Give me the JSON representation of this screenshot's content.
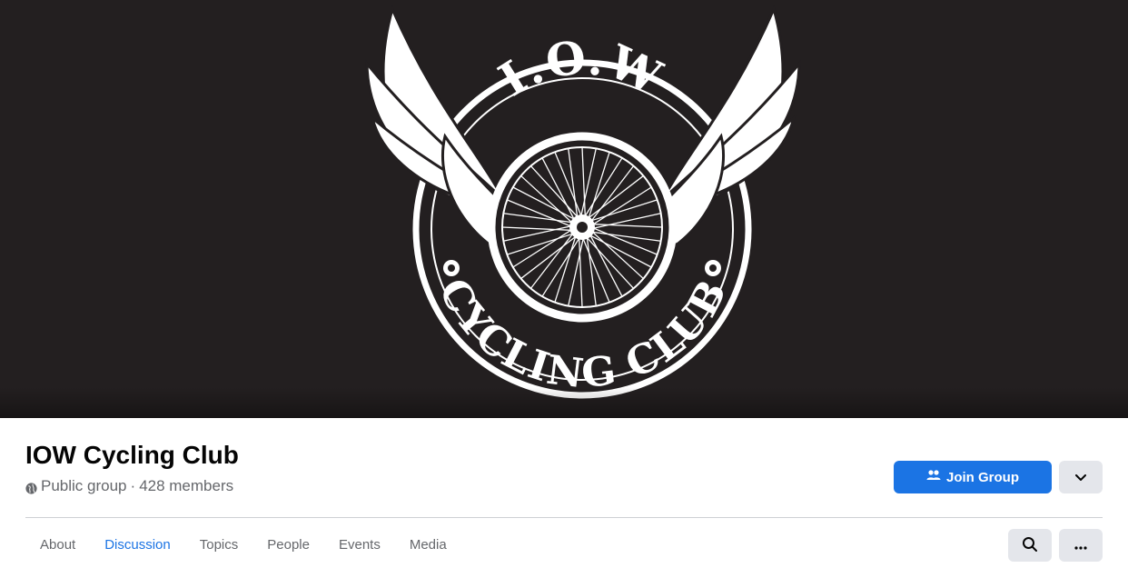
{
  "cover": {
    "logo_top_text": "I.O.W",
    "logo_bottom_text": "CYCLING CLUB"
  },
  "group": {
    "name": "IOW Cycling Club",
    "privacy": "Public group",
    "separator": " · ",
    "members": "428 members"
  },
  "actions": {
    "join_label": "Join Group"
  },
  "tabs": [
    {
      "label": "About",
      "active": false
    },
    {
      "label": "Discussion",
      "active": true
    },
    {
      "label": "Topics",
      "active": false
    },
    {
      "label": "People",
      "active": false
    },
    {
      "label": "Events",
      "active": false
    },
    {
      "label": "Media",
      "active": false
    }
  ],
  "colors": {
    "accent": "#1b74e4",
    "cover_bg": "#231f20",
    "button_gray": "#e4e6eb"
  },
  "icons": {
    "privacy": "globe-icon",
    "join": "people-icon",
    "dropdown": "chevron-down-icon",
    "search": "search-icon",
    "more": "more-dots-icon"
  }
}
